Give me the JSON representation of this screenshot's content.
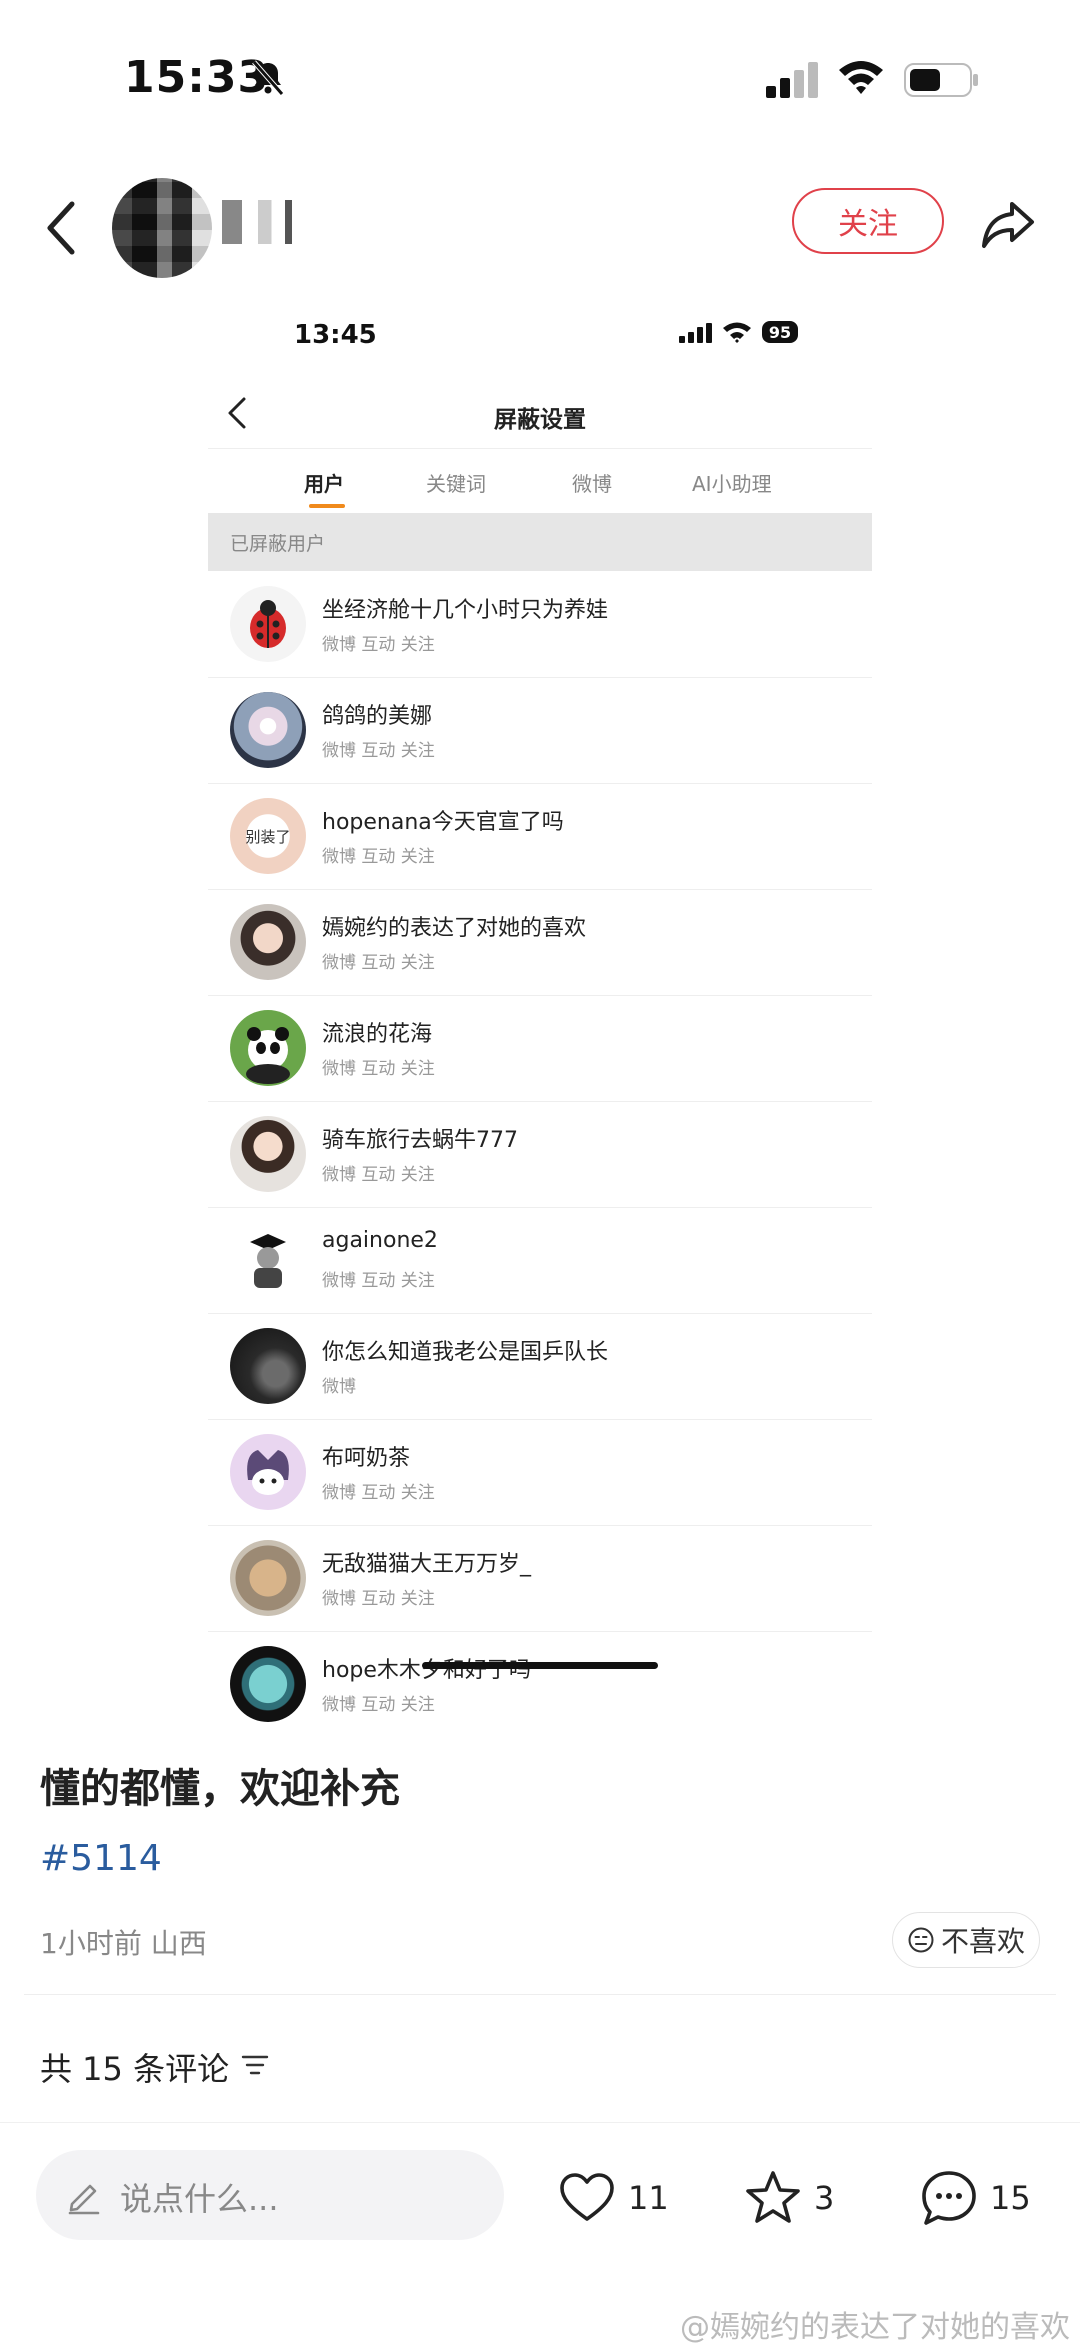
{
  "status_bar": {
    "time": "15:33"
  },
  "header": {
    "follow_label": "关注"
  },
  "embedded": {
    "time": "13:45",
    "battery": "95",
    "title": "屏蔽设置",
    "tabs": [
      {
        "label": "用户",
        "active": true
      },
      {
        "label": "关键词",
        "active": false
      },
      {
        "label": "微博",
        "active": false
      },
      {
        "label": "AI小助理",
        "active": false
      }
    ],
    "section_label": "已屏蔽用户",
    "users": [
      {
        "name": "坐经济舱十几个小时只为养娃",
        "meta": "微博 互动 关注",
        "avatar": "ladybug-avatar"
      },
      {
        "name": "鸽鸽的美娜",
        "meta": "微博 互动 关注",
        "avatar": "flower-avatar"
      },
      {
        "name": "hopenana今天官宣了吗",
        "meta": "微博 互动 关注",
        "avatar": "heart-hands-avatar",
        "avatar_text": "别装了"
      },
      {
        "name": "嫣婉约的表达了对她的喜欢",
        "meta": "微博 互动 关注",
        "avatar": "woman-photo-avatar"
      },
      {
        "name": "流浪的花海",
        "meta": "微博 互动 关注",
        "avatar": "panda-avatar"
      },
      {
        "name": "骑车旅行去蜗牛777",
        "meta": "微博 互动 关注",
        "avatar": "woman-photo-avatar"
      },
      {
        "name": "againone2",
        "meta": "微博 互动 关注",
        "avatar": "graduate-cartoon-avatar"
      },
      {
        "name": "你怎么知道我老公是国乒队长",
        "meta": "微博",
        "avatar": "dark-photo-avatar"
      },
      {
        "name": "布呵奶茶",
        "meta": "微博 互动 关注",
        "avatar": "kuromi-avatar"
      },
      {
        "name": "无敌猫猫大王万万岁_",
        "meta": "微博 互动 关注",
        "avatar": "cat-avatar"
      },
      {
        "name": "hope木木夕和好了吗",
        "meta": "微博 互动 关注",
        "avatar": "blue-object-avatar"
      }
    ]
  },
  "post": {
    "text": "懂的都懂，欢迎补充",
    "hashtag": "#5114",
    "meta": "1小时前 山西",
    "dislike_label": "不喜欢"
  },
  "comments": {
    "header": "共 15 条评论"
  },
  "bottom_bar": {
    "placeholder": "说点什么...",
    "likes": "11",
    "favorites": "3",
    "comments": "15"
  },
  "watermark": "@嫣婉约的表达了对她的喜欢",
  "colors": {
    "accent_red": "#e0414a",
    "tab_underline": "#f08a1c",
    "hashtag_blue": "#2a5c9e"
  }
}
